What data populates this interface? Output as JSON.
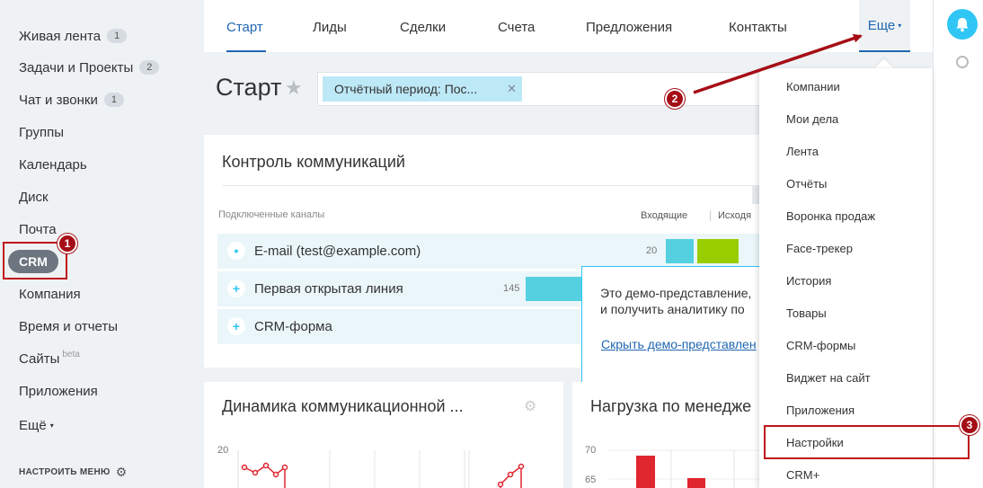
{
  "sidebar": {
    "items": [
      {
        "label": "Живая лента",
        "count": "1"
      },
      {
        "label": "Задачи и Проекты",
        "count": "2"
      },
      {
        "label": "Чат и звонки",
        "count": "1"
      },
      {
        "label": "Группы"
      },
      {
        "label": "Календарь"
      },
      {
        "label": "Диск"
      },
      {
        "label": "Почта"
      },
      {
        "label": "CRM"
      },
      {
        "label": "Компания"
      },
      {
        "label": "Время и отчеты"
      },
      {
        "label": "Сайты",
        "sup": "beta"
      },
      {
        "label": "Приложения"
      },
      {
        "label": "Ещё"
      }
    ],
    "settings_label": "НАСТРОИТЬ МЕНЮ"
  },
  "topnav": {
    "tabs": [
      "Старт",
      "Лиды",
      "Сделки",
      "Счета",
      "Предложения",
      "Контакты"
    ],
    "more": "Еще"
  },
  "page": {
    "title": "Старт",
    "filter_chip": "Отчётный период: Пос..."
  },
  "comm": {
    "title": "Контроль коммуникаций",
    "channels_label": "Подключенные каналы",
    "incoming_label": "Входящие",
    "outgoing_label": "Исходя",
    "rows": [
      {
        "icon": "•",
        "name": "E-mail (test@example.com)",
        "incoming": "20"
      },
      {
        "icon": "+",
        "name": "Первая открытая линия",
        "incoming": "145"
      },
      {
        "icon": "+",
        "name": "CRM-форма"
      }
    ]
  },
  "demo": {
    "line1": "Это демо-представление,",
    "line2": "и получить аналитику по",
    "link": "Скрыть демо-представлен"
  },
  "dyn": {
    "title": "Динамика коммуникационной ...",
    "axis_top": "20"
  },
  "load": {
    "title": "Нагрузка по менедже",
    "axis": [
      "70",
      "65"
    ]
  },
  "dropdown": {
    "items": [
      "Компании",
      "Мои дела",
      "Лента",
      "Отчёты",
      "Воронка продаж",
      "Face-трекер",
      "История",
      "Товары",
      "CRM-формы",
      "Виджет на сайт",
      "Приложения",
      "Настройки",
      "CRM+"
    ]
  },
  "markers": [
    "1",
    "2",
    "3"
  ],
  "colors": {
    "accent": "#2067b0",
    "highlight": "#c0121c",
    "cyan_bar": "#55d0e0",
    "green_bar": "#9acd00",
    "red_bar": "#e0262e"
  }
}
